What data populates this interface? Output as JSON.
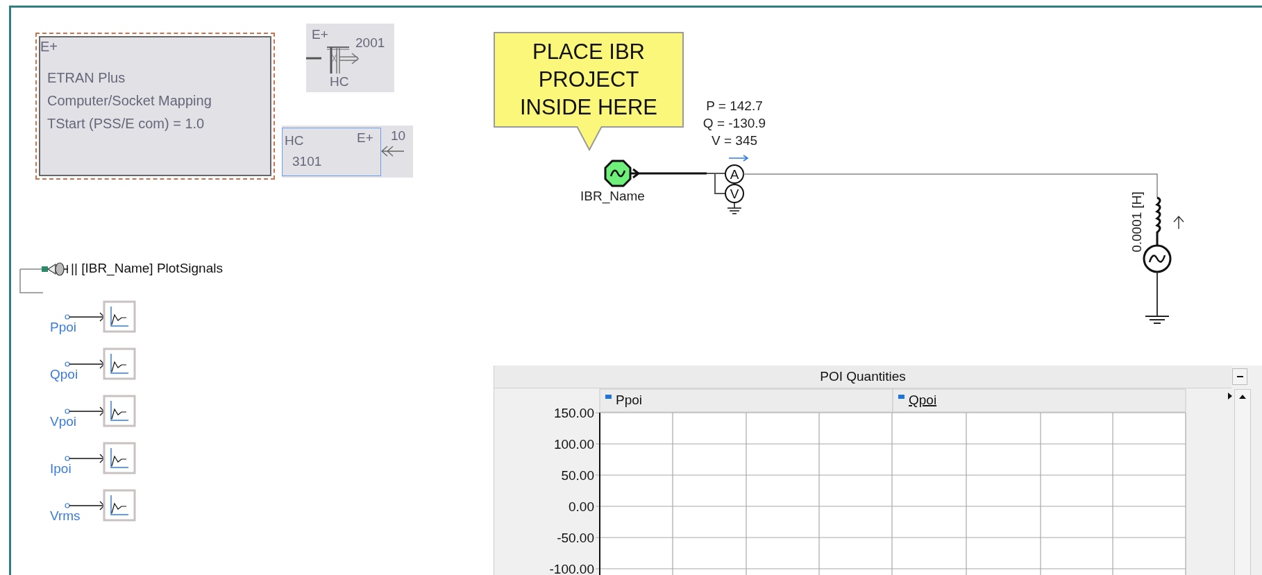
{
  "canvas": {
    "etran_block": {
      "badge": "E+",
      "lines": [
        "ETRAN Plus",
        "Computer/Socket Mapping",
        "TStart (PSS/E com) = 1.0"
      ],
      "selected": true
    },
    "interface_2001": {
      "badge": "E+",
      "number": "2001",
      "label": "HC"
    },
    "interface_3101": {
      "label": "HC",
      "badge": "E+",
      "number": "3101",
      "port": "10",
      "selected": true
    },
    "callout": {
      "lines": [
        "PLACE IBR",
        "PROJECT",
        "INSIDE HERE"
      ]
    },
    "source": {
      "name": "IBR_Name"
    },
    "meter_readings": [
      "P = 142.7",
      "Q = -130.9",
      "V = 345"
    ],
    "ammeter_symbol": "A",
    "voltmeter_symbol": "V",
    "inductor_label": "0.0001 [H]",
    "plot_signals": {
      "title": "|| [IBR_Name] PlotSignals",
      "signals": [
        "Ppoi",
        "Qpoi",
        "Vpoi",
        "Ipoi",
        "Vrms"
      ]
    }
  },
  "graph_panel": {
    "title": "POI Quantities",
    "legend_items": [
      {
        "selected": false
      },
      {
        "selected": true
      }
    ],
    "chart_data": {
      "type": "line",
      "grid": true,
      "ylim": [
        -100,
        150
      ],
      "series": [
        {
          "name": "Ppoi",
          "color": "#1e74d8"
        },
        {
          "name": "Qpoi",
          "color": "#1e74d8"
        }
      ],
      "yticks": [
        {
          "value": 150,
          "label": "150.00"
        },
        {
          "value": 100,
          "label": "100.00"
        },
        {
          "value": 50,
          "label": "50.00"
        },
        {
          "value": 0,
          "label": "0.00"
        },
        {
          "value": -50,
          "label": "-50.00"
        },
        {
          "value": -100,
          "label": "-100.00"
        }
      ]
    }
  }
}
